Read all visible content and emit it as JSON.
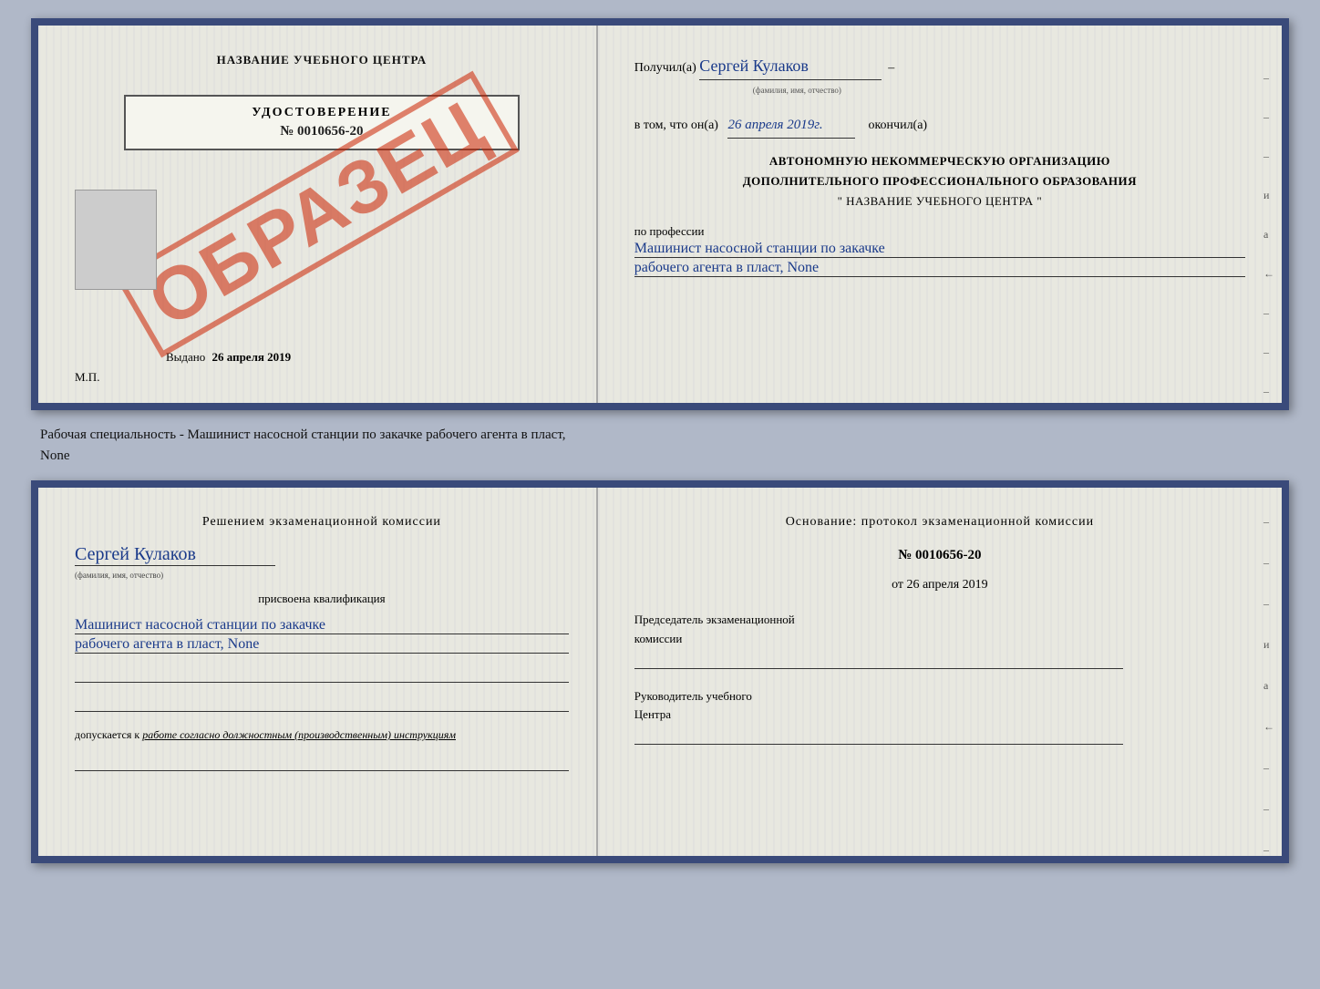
{
  "top_doc": {
    "left": {
      "center_title": "НАЗВАНИЕ УЧЕБНОГО ЦЕНТРА",
      "stamp_text": "ОБРАЗЕЦ",
      "udos_title": "УДОСТОВЕРЕНИЕ",
      "udos_num": "№ 0010656-20",
      "vydano_label": "Выдано",
      "vydano_date": "26 апреля 2019",
      "mp_label": "М.П."
    },
    "right": {
      "poluchil_label": "Получил(а)",
      "poluchil_name": "Сергей Кулаков",
      "poluchil_hint": "(фамилия, имя, отчество)",
      "vtom_label": "в том, что он(а)",
      "vtom_date": "26 апреля 2019г.",
      "okonchil_label": "окончил(а)",
      "anko_line1": "АВТОНОМНУЮ НЕКОММЕРЧЕСКУЮ ОРГАНИЗАЦИЮ",
      "anko_line2": "ДОПОЛНИТЕЛЬНОГО ПРОФЕССИОНАЛЬНОГО ОБРАЗОВАНИЯ",
      "anko_line3": "\"   НАЗВАНИЕ УЧЕБНОГО ЦЕНТРА   \"",
      "po_professii": "по профессии",
      "professii_1": "Машинист насосной станции по закачке",
      "professii_2": "рабочего агента в пласт, None",
      "dashes": [
        "-",
        "-",
        "-",
        "и",
        "а",
        "←",
        "-",
        "-",
        "-"
      ]
    }
  },
  "middle": {
    "text": "Рабочая специальность - Машинист насосной станции по закачке рабочего агента в пласт,",
    "text2": "None"
  },
  "bottom_doc": {
    "left": {
      "komissia_title": "Решением экзаменационной комиссии",
      "person_name": "Сергей Кулаков",
      "fio_hint": "(фамилия, имя, отчество)",
      "prisvoena": "присвоена квалификация",
      "kvalif_1": "Машинист насосной станции по закачке",
      "kvalif_2": "рабочего агента в пласт, None",
      "dopusk_label": "допускается к",
      "dopusk_text": "работе согласно должностным (производственным) инструкциям"
    },
    "right": {
      "osnovanie_title": "Основание: протокол экзаменационной комиссии",
      "protocol_num": "№ 0010656-20",
      "protocol_date_prefix": "от",
      "protocol_date": "26 апреля 2019",
      "predsedatel_label": "Председатель экзаменационной",
      "predsedatel_label2": "комиссии",
      "rukovoditel_label": "Руководитель учебного",
      "rukovoditel_label2": "Центра",
      "dashes": [
        "-",
        "-",
        "-",
        "и",
        "а",
        "←",
        "-",
        "-",
        "-"
      ]
    }
  }
}
